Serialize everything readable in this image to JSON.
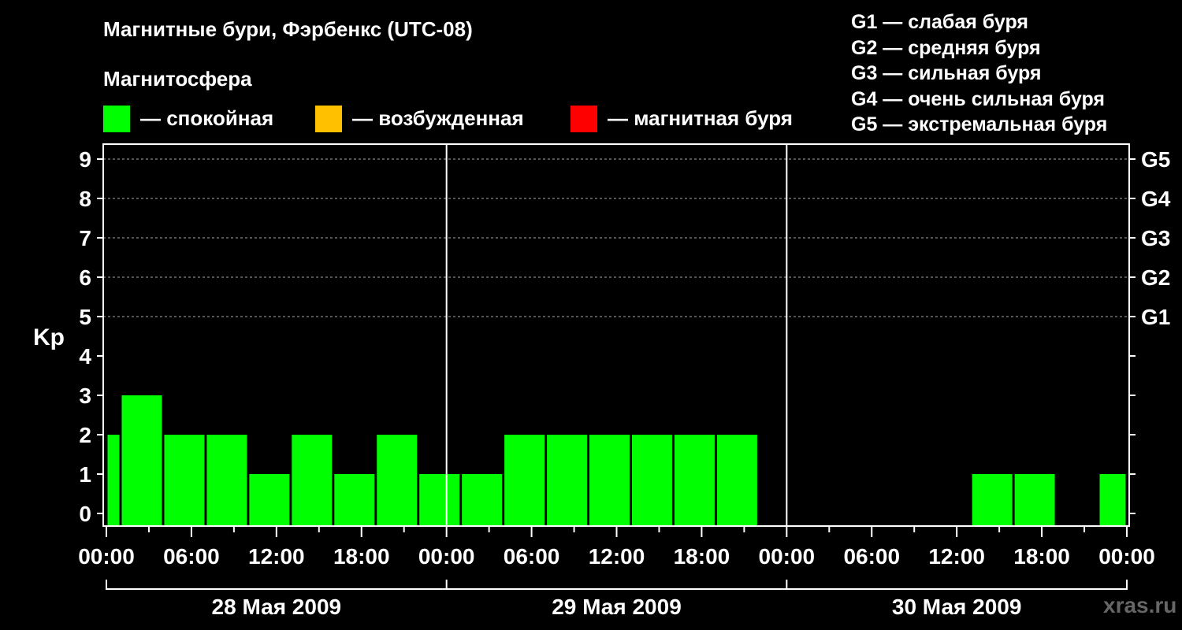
{
  "header": {
    "title": "Магнитные бури, Фэрбенкс (UTC-08)",
    "magnetosphere_label": "Магнитосфера"
  },
  "legend": [
    {
      "label": "— спокойная",
      "color": "#00ff00"
    },
    {
      "label": "— возбужденная",
      "color": "#ffc000"
    },
    {
      "label": "— магнитная буря",
      "color": "#ff0000"
    }
  ],
  "g_scale": [
    "G1 — слабая буря",
    "G2 — средняя буря",
    "G3 — сильная буря",
    "G4 — очень сильная буря",
    "G5 — экстремальная буря"
  ],
  "watermark": "xras.ru",
  "chart_data": {
    "type": "bar",
    "ylabel": "Kp",
    "ylim": [
      0,
      9
    ],
    "yticks": [
      "0",
      "1",
      "2",
      "3",
      "4",
      "5",
      "6",
      "7",
      "8",
      "9"
    ],
    "right_ticks": [
      {
        "kp": 5,
        "label": "G1"
      },
      {
        "kp": 6,
        "label": "G2"
      },
      {
        "kp": 7,
        "label": "G3"
      },
      {
        "kp": 8,
        "label": "G4"
      },
      {
        "kp": 9,
        "label": "G5"
      }
    ],
    "x_range_hours": [
      0,
      72
    ],
    "xtick_labels": [
      "00:00",
      "06:00",
      "12:00",
      "18:00",
      "00:00",
      "06:00",
      "12:00",
      "18:00",
      "00:00",
      "06:00",
      "12:00",
      "18:00",
      "00:00"
    ],
    "days": [
      "28 Мая 2009",
      "29 Мая 2009",
      "30 Мая 2009"
    ],
    "bar_color": "#00ff00",
    "bars": [
      {
        "start": 0,
        "end": 1,
        "kp": 2
      },
      {
        "start": 1,
        "end": 4,
        "kp": 3
      },
      {
        "start": 4,
        "end": 7,
        "kp": 2
      },
      {
        "start": 7,
        "end": 10,
        "kp": 2
      },
      {
        "start": 10,
        "end": 13,
        "kp": 1
      },
      {
        "start": 13,
        "end": 16,
        "kp": 2
      },
      {
        "start": 16,
        "end": 19,
        "kp": 1
      },
      {
        "start": 19,
        "end": 22,
        "kp": 2
      },
      {
        "start": 22,
        "end": 25,
        "kp": 1
      },
      {
        "start": 25,
        "end": 28,
        "kp": 1
      },
      {
        "start": 28,
        "end": 31,
        "kp": 2
      },
      {
        "start": 31,
        "end": 34,
        "kp": 2
      },
      {
        "start": 34,
        "end": 37,
        "kp": 2
      },
      {
        "start": 37,
        "end": 40,
        "kp": 2
      },
      {
        "start": 40,
        "end": 43,
        "kp": 2
      },
      {
        "start": 43,
        "end": 46,
        "kp": 2
      },
      {
        "start": 61,
        "end": 64,
        "kp": 1
      },
      {
        "start": 64,
        "end": 67,
        "kp": 1
      },
      {
        "start": 70,
        "end": 72,
        "kp": 1
      }
    ]
  }
}
